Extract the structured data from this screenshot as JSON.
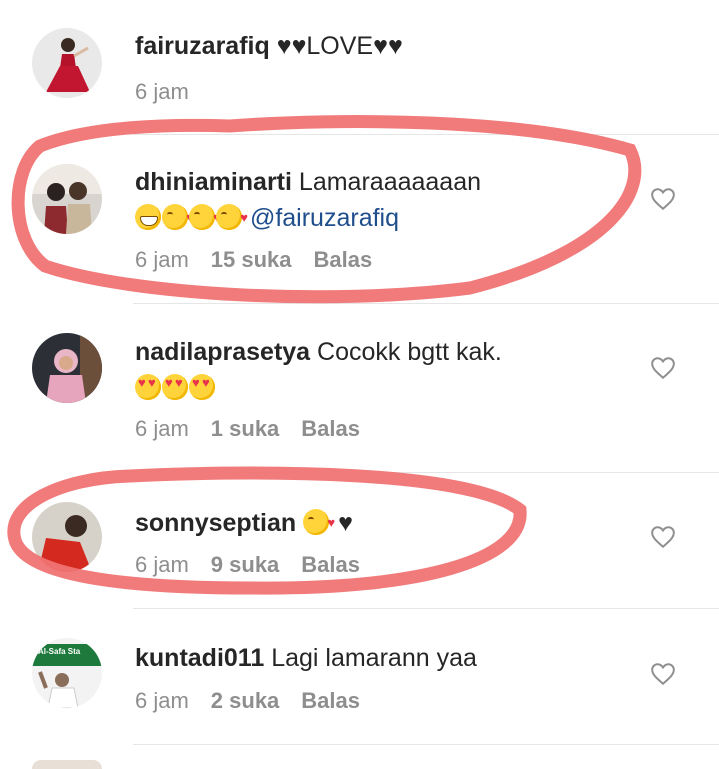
{
  "comments": [
    {
      "username": "fairuzarafiq",
      "text": "♥♥LOVE♥♥",
      "time": "6 jam",
      "likes": "",
      "reply": "",
      "avatar": "avatar-woman-red-dress"
    },
    {
      "username": "dhiniaminarti",
      "text": "Lamaraaaaaaan",
      "mention": "@fairuzarafiq",
      "time": "6 jam",
      "likes": "15 suka",
      "reply": "Balas",
      "avatar": "avatar-couple"
    },
    {
      "username": "nadilaprasetya",
      "text": "Cocokk bgtt kak.",
      "time": "6 jam",
      "likes": "1 suka",
      "reply": "Balas",
      "avatar": "avatar-hijab-woman"
    },
    {
      "username": "sonnyseptian",
      "text": "♥",
      "time": "6 jam",
      "likes": "9 suka",
      "reply": "Balas",
      "avatar": "avatar-man-red-shirt"
    },
    {
      "username": "kuntadi011",
      "text": "Lagi lamarann yaa",
      "time": "6 jam",
      "likes": "2 suka",
      "reply": "Balas",
      "avatar": "avatar-al-safa"
    }
  ],
  "avatar5_sign": "Al-Safa Sta",
  "colors": {
    "highlight": "#f07373",
    "mention": "#1f4e8c",
    "meta": "#8e8e8e"
  }
}
